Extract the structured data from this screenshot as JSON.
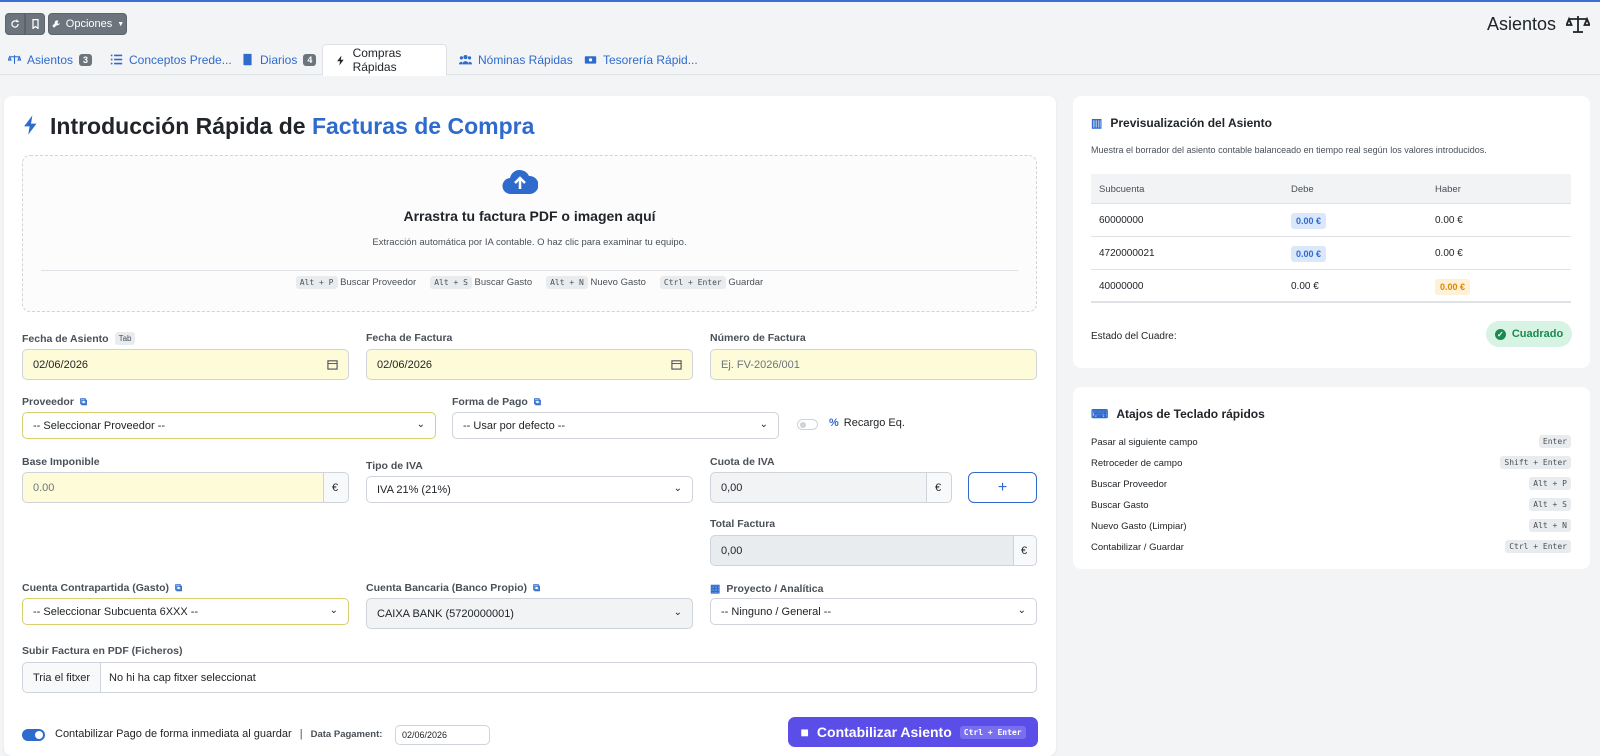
{
  "header": {
    "options_label": "Opciones",
    "page_title": "Asientos"
  },
  "tabs": [
    {
      "label": "Asientos",
      "badge": "3"
    },
    {
      "label": "Conceptos Prede..."
    },
    {
      "label": "Diarios",
      "badge": "4"
    },
    {
      "label": "Compras Rápidas"
    },
    {
      "label": "Nóminas Rápidas"
    },
    {
      "label": "Tesorería Rápid..."
    }
  ],
  "form": {
    "title_part1": "Introducción Rápida de",
    "title_part2": "Facturas de Compra",
    "drop_title": "Arrastra tu factura PDF o imagen aquí",
    "drop_sub": "Extracción automática por IA contable. O haz clic para examinar tu equipo.",
    "shortcuts": [
      {
        "key": "Alt + P",
        "label": "Buscar Proveedor"
      },
      {
        "key": "Alt + S",
        "label": "Buscar Gasto"
      },
      {
        "key": "Alt + N",
        "label": "Nuevo Gasto"
      },
      {
        "key": "Ctrl + Enter",
        "label": "Guardar"
      }
    ],
    "fecha_asiento_label": "Fecha de Asiento",
    "tab_hint": "Tab",
    "fecha_asiento_value": "02/06/2026",
    "fecha_factura_label": "Fecha de Factura",
    "fecha_factura_value": "02/06/2026",
    "numero_factura_label": "Número de Factura",
    "numero_factura_placeholder": "Ej. FV-2026/001",
    "proveedor_label": "Proveedor",
    "proveedor_value": "-- Seleccionar Proveedor --",
    "forma_pago_label": "Forma de Pago",
    "forma_pago_value": "-- Usar por defecto --",
    "recargo_label": "Recargo Eq.",
    "base_label": "Base Imponible",
    "base_value": "0.00",
    "currency": "€",
    "tipo_iva_label": "Tipo de IVA",
    "tipo_iva_value": "IVA 21% (21%)",
    "cuota_label": "Cuota de IVA",
    "cuota_value": "0,00",
    "add_button": "+",
    "total_label": "Total Factura",
    "total_value": "0,00",
    "contrapartida_label": "Cuenta Contrapartida (Gasto)",
    "contrapartida_value": "-- Seleccionar Subcuenta 6XXX --",
    "bancaria_label": "Cuenta Bancaria (Banco Propio)",
    "bancaria_value": "CAIXA BANK (5720000001)",
    "proyecto_label": "Proyecto / Analítica",
    "proyecto_value": "-- Ninguno / General --",
    "subir_label": "Subir Factura en PDF (Ficheros)",
    "file_button": "Tria el fitxer",
    "file_status": "No hi ha cap fitxer seleccionat",
    "pago_toggle_label": "Contabilizar Pago de forma inmediata al guardar",
    "data_pagament_label": "Data Pagament:",
    "data_pagament_value": "02/06/2026",
    "submit_label": "Contabilizar Asiento",
    "submit_kbd": "Ctrl + Enter"
  },
  "preview": {
    "title": "Previsualización del Asiento",
    "subtitle": "Muestra el borrador del asiento contable balanceado en tiempo real según los valores introducidos.",
    "columns": [
      "Subcuenta",
      "Debe",
      "Haber"
    ],
    "rows": [
      {
        "subcuenta": "60000000",
        "debe": "0.00 €",
        "haber": "0.00 €"
      },
      {
        "subcuenta": "4720000021",
        "debe": "0.00 €",
        "haber": "0.00 €"
      },
      {
        "subcuenta": "40000000",
        "debe": "0.00 €",
        "haber": "0.00 €"
      }
    ],
    "estado_label": "Estado del Cuadre:",
    "estado_value": "Cuadrado"
  },
  "shortcuts_panel": {
    "title": "Atajos de Teclado rápidos",
    "items": [
      {
        "label": "Pasar al siguiente campo",
        "key": "Enter"
      },
      {
        "label": "Retroceder de campo",
        "key": "Shift + Enter"
      },
      {
        "label": "Buscar Proveedor",
        "key": "Alt + P"
      },
      {
        "label": "Buscar Gasto",
        "key": "Alt + S"
      },
      {
        "label": "Nuevo Gasto (Limpiar)",
        "key": "Alt + N"
      },
      {
        "label": "Contabilizar / Guardar",
        "key": "Ctrl + Enter"
      }
    ]
  }
}
